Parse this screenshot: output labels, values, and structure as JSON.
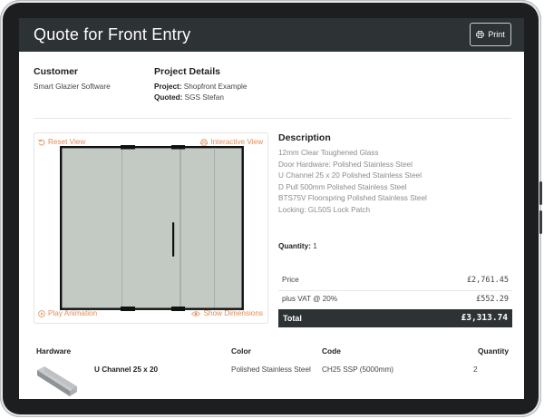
{
  "header": {
    "title": "Quote for Front Entry",
    "print_label": "Print"
  },
  "customer": {
    "heading": "Customer",
    "name": "Smart Glazier Software"
  },
  "project": {
    "heading": "Project Details",
    "project_label": "Project:",
    "project_value": "Shopfront Example",
    "quoted_label": "Quoted:",
    "quoted_value": "SGS Stefan"
  },
  "viewer": {
    "reset_view": "Reset View",
    "interactive_view": "Interactive View",
    "play_animation": "Play Animation",
    "show_dimensions": "Show Dimensions",
    "glass_color": "#c3cac4",
    "frame_color": "#111111"
  },
  "description": {
    "heading": "Description",
    "lines": [
      "12mm Clear Toughened Glass",
      "Door Hardware: Polished Stainless Steel",
      "U Channel 25 x 20 Polished Stainless Steel",
      "D Pull 500mm Polished Stainless Steel",
      "BTS75V Floorspring Polished Stainless Steel",
      "Locking: GL50S Lock Patch"
    ],
    "quantity_label": "Quantity:",
    "quantity_value": "1"
  },
  "pricing": {
    "price_label": "Price",
    "price_value": "£2,761.45",
    "vat_label": "plus VAT @ 20%",
    "vat_value": "£552.29",
    "total_label": "Total",
    "total_value": "£3,313.74"
  },
  "hardware_table": {
    "headers": [
      "Hardware",
      "Color",
      "Code",
      "Quantity"
    ],
    "rows": [
      {
        "name": "U Channel 25 x 20",
        "color": "Polished Stainless Steel",
        "code": "CH25 SSP (5000mm)",
        "quantity": "2"
      }
    ]
  },
  "colors": {
    "titlebar": "#2d3235",
    "accent": "#e28a55"
  }
}
